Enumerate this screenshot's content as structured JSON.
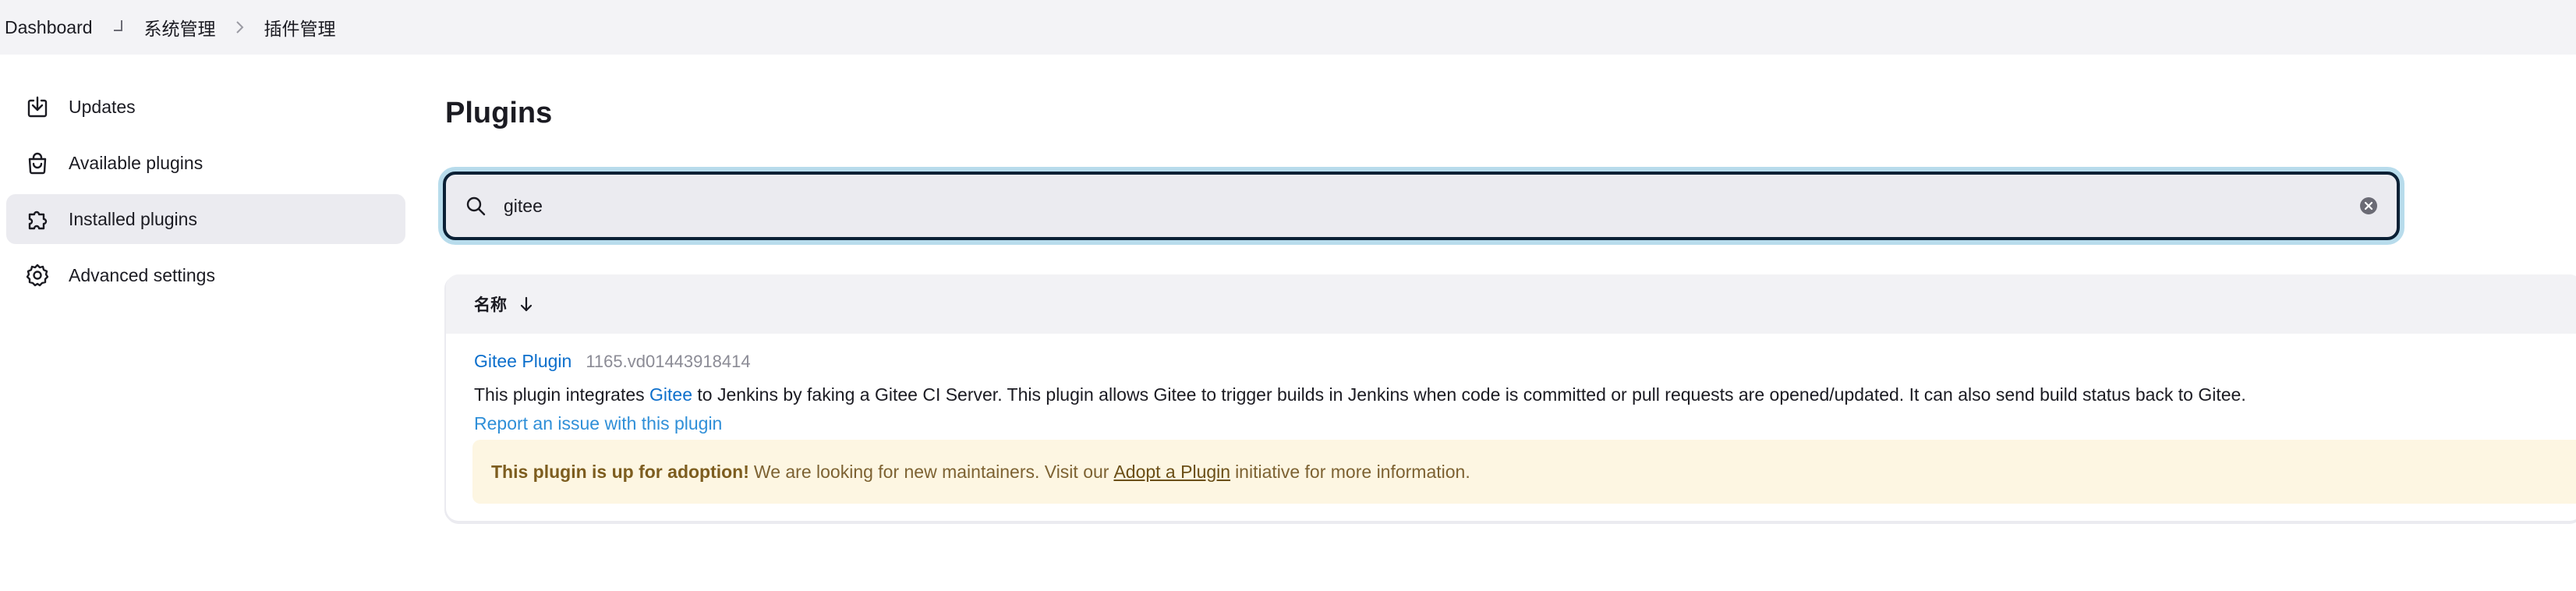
{
  "breadcrumbs": {
    "home": "Dashboard",
    "system": "系统管理",
    "plugins": "插件管理"
  },
  "sidebar": {
    "items": [
      {
        "label": "Updates",
        "icon": "download-icon"
      },
      {
        "label": "Available plugins",
        "icon": "shopping-bag-icon"
      },
      {
        "label": "Installed plugins",
        "icon": "puzzle-icon",
        "active": true
      },
      {
        "label": "Advanced settings",
        "icon": "gear-icon"
      }
    ]
  },
  "main": {
    "title": "Plugins",
    "search": {
      "value": "gitee"
    },
    "table": {
      "column_name": "名称",
      "rows": [
        {
          "name": "Gitee Plugin",
          "version": "1165.vd01443918414",
          "desc_prefix": "This plugin integrates ",
          "desc_link": "Gitee",
          "desc_suffix": " to Jenkins by faking a Gitee CI Server. This plugin allows Gitee to trigger builds in Jenkins when code is committed or pull requests are opened/updated. It can also send build status back to Gitee.",
          "report_link": "Report an issue with this plugin",
          "adoption": {
            "bold": "This plugin is up for adoption!",
            "text_before": "We are looking for new maintainers. Visit our",
            "link": "Adopt a Plugin",
            "text_after": "initiative for more information."
          }
        }
      ]
    }
  },
  "colors": {
    "accent_link": "#0c6fcc",
    "focus_ring": "#b8dcec",
    "adoption_bg": "#fdf6e2"
  }
}
